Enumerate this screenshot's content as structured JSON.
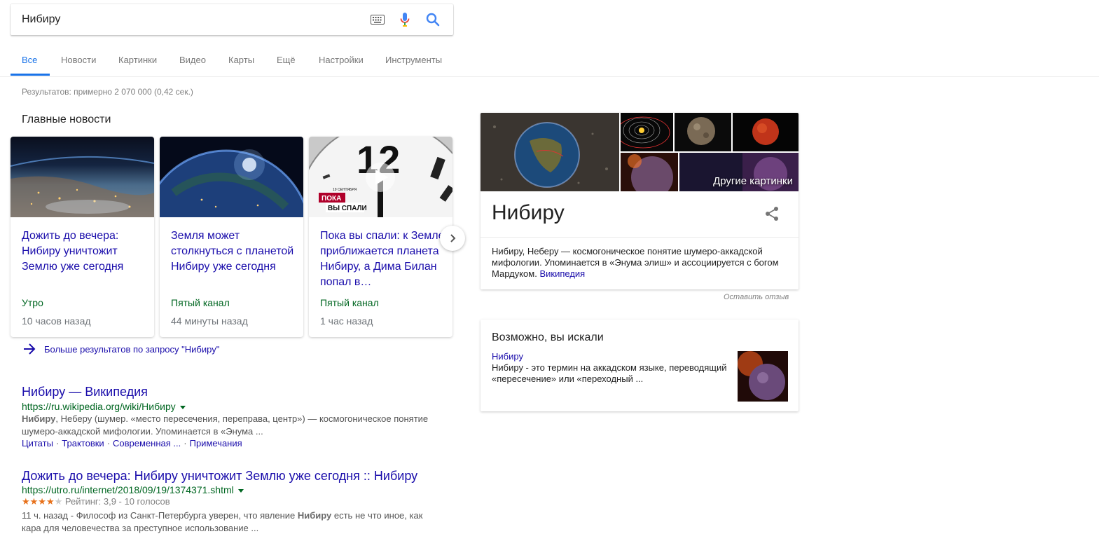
{
  "search": {
    "query": "Нибиру"
  },
  "tabs": [
    {
      "label": "Все"
    },
    {
      "label": "Новости"
    },
    {
      "label": "Картинки"
    },
    {
      "label": "Видео"
    },
    {
      "label": "Карты"
    },
    {
      "label": "Ещё"
    },
    {
      "label": "Настройки"
    },
    {
      "label": "Инструменты"
    }
  ],
  "stats": "Результатов: примерно 2 070 000 (0,42 сек.)",
  "top_stories": {
    "title": "Главные новости",
    "cards": [
      {
        "headline": "Дожить до вечера: Нибиру уничтожит Землю уже сегодня",
        "source": "Утро",
        "time": "10 часов назад"
      },
      {
        "headline": "Земля может столкнуться с планетой Нибиру уже сегодня",
        "source": "Пятый канал",
        "time": "44 минуты назад"
      },
      {
        "headline": "Пока вы спали: к Земле приближается планета Нибиру, а Дима Билан попал в…",
        "source": "Пятый канал",
        "time": "1 час назад",
        "thumb_text_1": "ПОКА",
        "thumb_text_2": "ВЫ СПАЛИ",
        "thumb_text_3": "19 СЕНТЯБРЯ"
      }
    ],
    "more_link": "Больше результатов по запросу \"Нибиру\""
  },
  "results": [
    {
      "title": "Нибиру — Википедия",
      "url": "https://ru.wikipedia.org/wiki/Нибиру",
      "snippet_bold": "Нибиру",
      "snippet_rest": ", Неберу (шумер. «место пересечения, переправа, центр») — космогоническое понятие шумеро-аккадской мифологии. Упоминается в «Энума ...",
      "sitelinks": [
        "Цитаты",
        "Трактовки",
        "Современная ...",
        "Примечания"
      ]
    },
    {
      "title": "Дожить до вечера: Нибиру уничтожит Землю уже сегодня :: Нибиру",
      "url": "https://utro.ru/internet/2018/09/19/1374371.shtml",
      "stars_on": "★★★★",
      "stars_off": "★",
      "rating": "Рейтинг: 3,9 - 10 голосов",
      "snippet_pre": "11 ч. назад - Философ из Санкт-Петербурга уверен, что явление ",
      "snippet_bold": "Нибиру",
      "snippet_post": " есть не что иное, как кара для человечества за преступное использование ..."
    }
  ],
  "knowledge_panel": {
    "title": "Нибиру",
    "more_images": "Другие картинки",
    "desc": "Нибиру, Неберу — космогоническое понятие шумеро-аккадской мифологии. Упоминается в «Энума элиш» и ассоциируется с богом Мардуком.",
    "source": "Википедия",
    "feedback": "Оставить отзыв"
  },
  "people_also": {
    "title": "Возможно, вы искали",
    "link": "Нибиру",
    "snippet": "Нибиру - это термин на аккадском языке, переводящий «пересечение» или «переходный ..."
  },
  "colors": {
    "accent": "#1a73e8",
    "link": "#1a0dab",
    "url": "#006621",
    "star": "#e7711b"
  }
}
